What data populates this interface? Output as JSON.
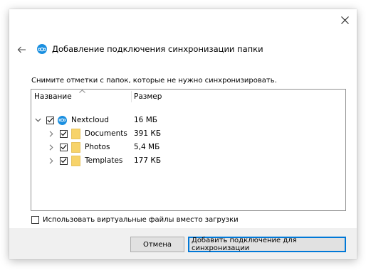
{
  "dialog": {
    "title": "Добавление подключения синхронизации папки",
    "instruction": "Снимите отметки с папок, которые не нужно синхронизировать."
  },
  "tree": {
    "columns": {
      "name": "Название",
      "size": "Размер"
    },
    "root": {
      "name": "Nextcloud",
      "size": "16 МБ",
      "checked": true,
      "expanded": true
    },
    "children": [
      {
        "name": "Documents",
        "size": "391 КБ",
        "checked": true,
        "expanded": false
      },
      {
        "name": "Photos",
        "size": "5,4 МБ",
        "checked": true,
        "expanded": false
      },
      {
        "name": "Templates",
        "size": "177 КБ",
        "checked": true,
        "expanded": false
      }
    ]
  },
  "virtual_files": {
    "label": "Использовать виртуальные файлы вместо загрузки",
    "checked": false
  },
  "buttons": {
    "cancel": "Отмена",
    "add": "Добавить подключение для синхронизации"
  },
  "colors": {
    "accent": "#0078d7",
    "nextcloud": "#1a8fe0",
    "folder": "#f7d36a"
  },
  "icons": [
    "close-icon",
    "back-arrow-icon",
    "nextcloud-logo-icon",
    "folder-icon",
    "chevron-down-icon",
    "chevron-right-icon",
    "checkmark-icon",
    "sort-up-icon"
  ]
}
